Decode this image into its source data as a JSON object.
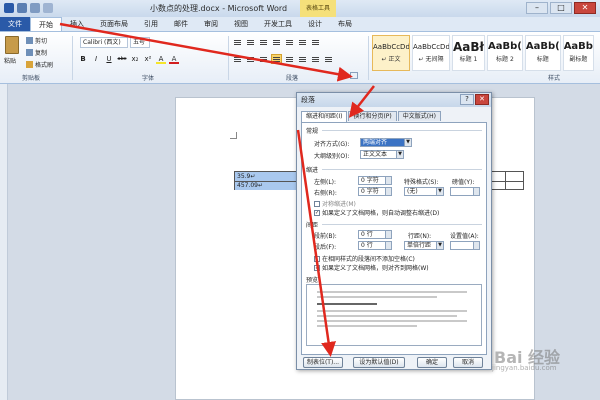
{
  "window": {
    "title": "小数点的处理.docx - Microsoft Word",
    "context_tab": "表格工具",
    "controls": [
      "–",
      "□",
      "✕"
    ]
  },
  "tabs": [
    "文件",
    "开始",
    "插入",
    "页面布局",
    "引用",
    "邮件",
    "审阅",
    "视图",
    "开发工具",
    "设计",
    "布局"
  ],
  "clipboard": {
    "paste": "粘贴",
    "cut": "剪切",
    "copy": "复制",
    "format_painter": "格式刷",
    "group_label": "剪贴板"
  },
  "font": {
    "name": "Calibri (西文)",
    "size": "五号",
    "group_label": "字体",
    "buttons": [
      "B",
      "I",
      "U",
      "abc",
      "x₂",
      "x²",
      "A",
      "A"
    ]
  },
  "paragraph": {
    "group_label": "段落"
  },
  "styles": {
    "group_label": "样式",
    "cards": [
      {
        "sample": "AaBbCcDd",
        "name": "↵ 正文"
      },
      {
        "sample": "AaBbCcDd",
        "name": "↵ 无间隔"
      },
      {
        "sample": "AaBł",
        "name": "标题 1"
      },
      {
        "sample": "AaBb(",
        "name": "标题 2"
      },
      {
        "sample": "AaBb(",
        "name": "标题"
      },
      {
        "sample": "AaBb",
        "name": "副标题"
      }
    ]
  },
  "document": {
    "cells": [
      "35.9↵",
      "457.09↵"
    ]
  },
  "dialog": {
    "title": "段落",
    "help": "?",
    "close": "✕",
    "tabs": [
      "缩进和间距(I)",
      "换行和分页(P)",
      "中文版式(H)"
    ],
    "general": {
      "title": "常规",
      "align_label": "对齐方式(G):",
      "align_value": "两端对齐",
      "outline_label": "大纲级别(O):",
      "outline_value": "正文文本"
    },
    "indent": {
      "title": "缩进",
      "left_label": "左侧(L):",
      "left_value": "0 字符",
      "right_label": "右侧(R):",
      "right_value": "0 字符",
      "special_label": "特殊格式(S):",
      "special_value": "(无)",
      "measure_label": "磅值(Y):",
      "mirror": "对称缩进(M)",
      "auto_adjust": "如果定义了文档网格，则自动调整右缩进(D)"
    },
    "spacing": {
      "title": "间距",
      "before_label": "段前(B):",
      "before_value": "0 行",
      "after_label": "段后(F):",
      "after_value": "0 行",
      "line_label": "行距(N):",
      "line_value": "单倍行距",
      "at_label": "设置值(A):",
      "no_space": "在相同样式的段落间不添加空格(C)",
      "snap_grid": "如果定义了文档网格，则对齐到网格(W)"
    },
    "preview_title": "预览",
    "buttons": {
      "tabs": "制表位(T)...",
      "default": "设为默认值(D)",
      "ok": "确定",
      "cancel": "取消"
    }
  },
  "watermark": {
    "main": "Bai 经验",
    "sub": "jingyan.baidu.com"
  }
}
